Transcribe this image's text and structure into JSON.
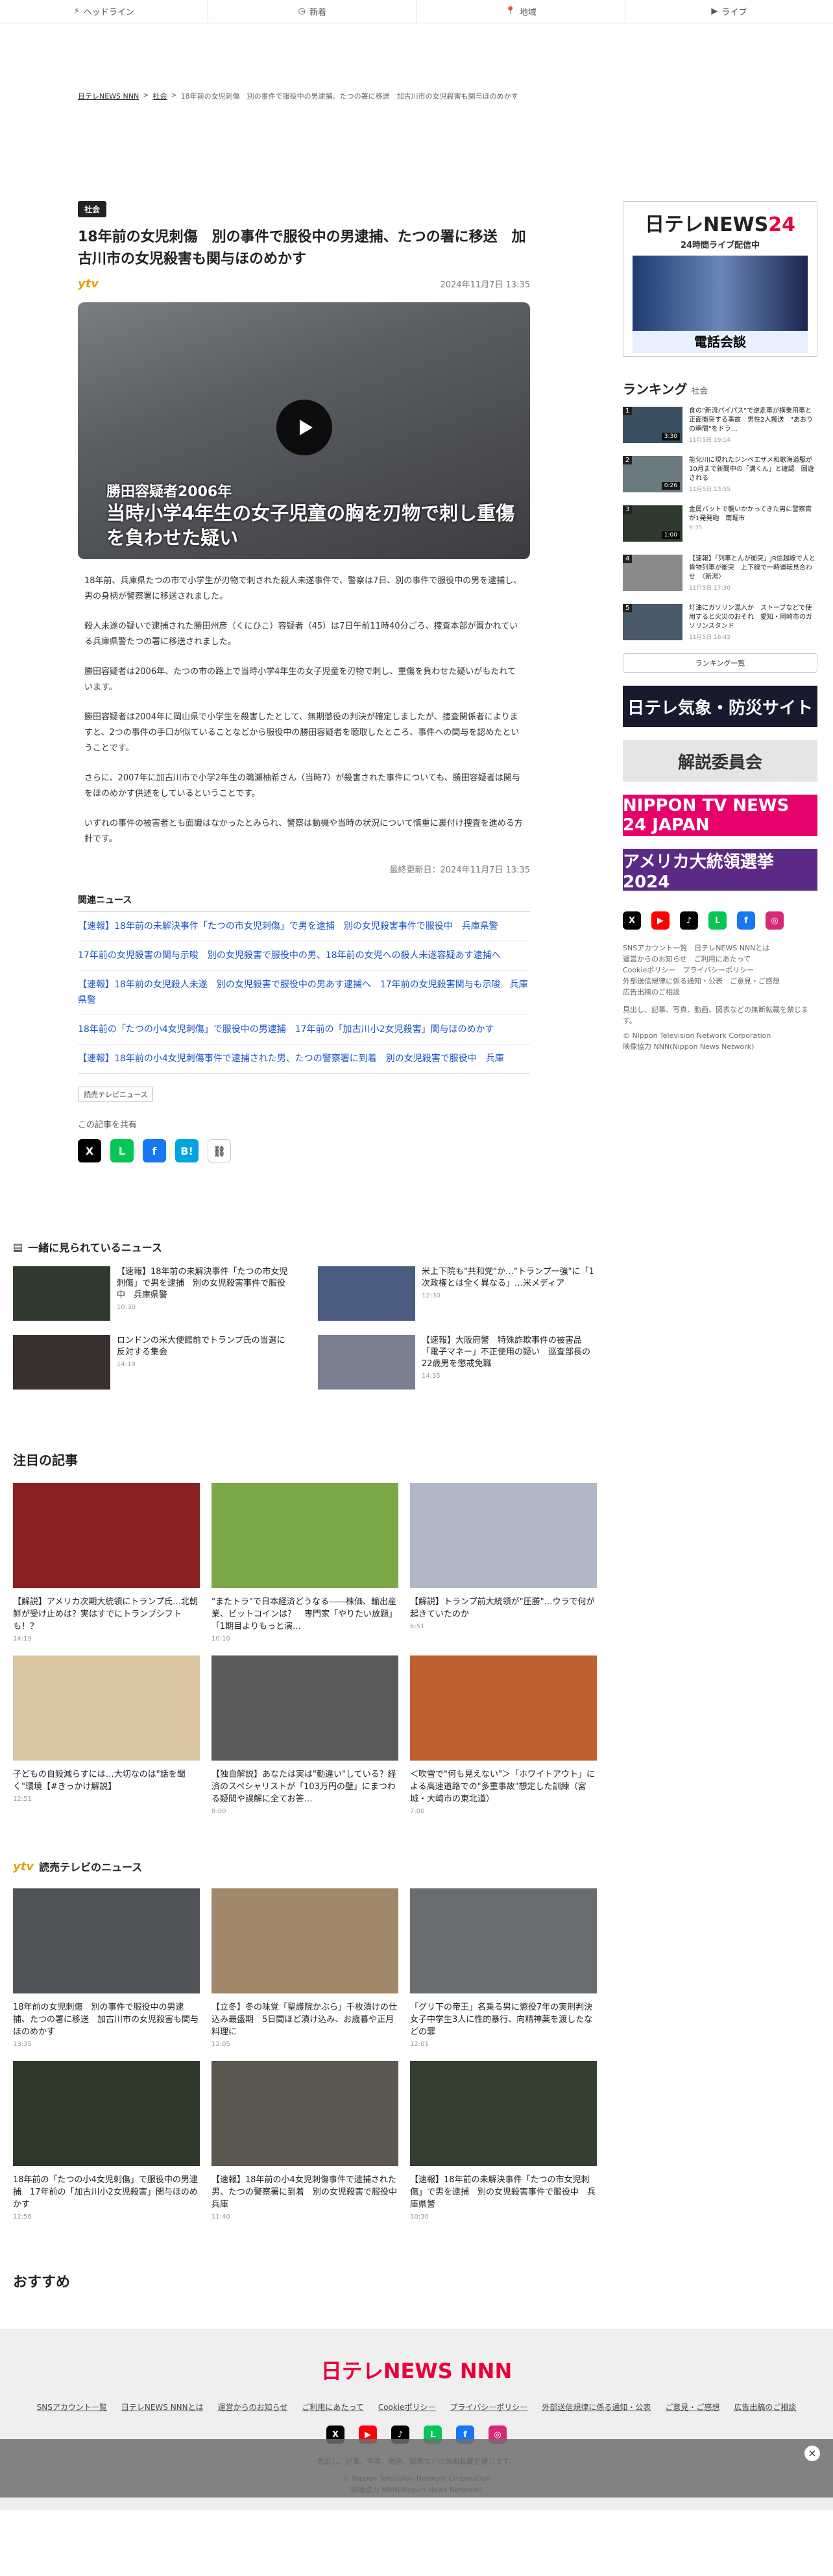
{
  "nav": [
    {
      "label": "ヘッドライン",
      "icon": "bolt-icon"
    },
    {
      "label": "新着",
      "icon": "clock-icon"
    },
    {
      "label": "地域",
      "icon": "pin-icon"
    },
    {
      "label": "ライブ",
      "icon": "play-icon"
    }
  ],
  "breadcrumb": {
    "home": "日テレNEWS NNN",
    "sep": ">",
    "category": "社会",
    "current": "18年前の女児刺傷　別の事件で服役中の男逮捕、たつの署に移送　加古川市の女児殺害も関与ほのめかす"
  },
  "article": {
    "category": "社会",
    "title": "18年前の女児刺傷　別の事件で服役中の男逮捕、たつの署に移送　加古川市の女児殺害も関与ほのめかす",
    "source_logo": "ytv",
    "date": "2024年11月7日 13:35",
    "video_caption_small": "勝田容疑者2006年",
    "video_caption_big": "当時小学4年生の女子児童の胸を刃物で刺し重傷を負わせた疑い",
    "paragraphs": [
      "18年前、兵庫県たつの市で小学生が刃物で刺された殺人未遂事件で、警察は7日、別の事件で服役中の男を逮捕し、男の身柄が警察署に移送されました。",
      "殺人未遂の疑いで逮捕された勝田州彦（くにひこ）容疑者（45）は7日午前11時40分ごろ、捜査本部が置かれている兵庫県警たつの署に移送されました。",
      "勝田容疑者は2006年、たつの市の路上で当時小学4年生の女子児童を刃物で刺し、重傷を負わせた疑いがもたれています。",
      "勝田容疑者は2004年に岡山県で小学生を殺害したとして、無期懲役の判決が確定しましたが、捜査関係者によりますと、2つの事件の手口が似ていることなどから服役中の勝田容疑者を聴取したところ、事件への関与を認めたということです。",
      "さらに、2007年に加古川市で小学2年生の鵜瀬柚希さん（当時7）が殺害された事件についても、勝田容疑者は関与をほのめかす供述をしているということです。",
      "いずれの事件の被害者とも面識はなかったとみられ、警察は動機や当時の状況について慎重に裏付け捜査を進める方針です。"
    ],
    "updated": "最終更新日：2024年11月7日 13:35",
    "related_heading": "関連ニュース",
    "related": [
      "【速報】18年前の未解決事件「たつの市女児刺傷」で男を逮捕　別の女児殺害事件で服役中　兵庫県警",
      "17年前の女児殺害の関与示唆　別の女児殺害で服役中の男、18年前の女児への殺人未遂容疑あす逮捕へ",
      "【速報】18年前の女児殺人未遂　別の女児殺害で服役中の男あす逮捕へ　17年前の女児殺害関与も示唆　兵庫県警",
      "18年前の「たつの小4女児刺傷」で服役中の男逮捕　17年前の「加古川小2女児殺害」関与ほのめかす",
      "【速報】18年前の小4女児刺傷事件で逮捕された男、たつの警察署に到着　別の女児殺害で服役中　兵庫"
    ],
    "source_tag": "読売テレビニュース",
    "share_label": "この記事を共有"
  },
  "share_icons": [
    {
      "name": "x-share-icon",
      "glyph": "X",
      "color": "#000000"
    },
    {
      "name": "line-share-icon",
      "glyph": "L",
      "color": "#06c755"
    },
    {
      "name": "facebook-share-icon",
      "glyph": "f",
      "color": "#1877f2"
    },
    {
      "name": "hatena-share-icon",
      "glyph": "B!",
      "color": "#00a4de"
    },
    {
      "name": "link-share-icon",
      "glyph": "⛓",
      "color": "#9aa0a6"
    }
  ],
  "sidebar": {
    "live_logo_main": "日テレNEWS",
    "live_logo_num": "24",
    "live_sub": "24時間ライブ配信中",
    "live_bar": "電話会談",
    "ranking_title": "ランキング",
    "ranking_sub": "社会",
    "ranking": [
      {
        "text": "食の\"新流パイパス\"で逆走車が横乗用車と正面衝突する事故　男性2人搬送　\"あおりの瞬間\"をドラ…",
        "src": "11月5日 19:14",
        "dur": "3:30"
      },
      {
        "text": "能化川に現れたジンベエザメ和歌海道駆が10月まで新聞中の「溝くん」と確認　回遊される",
        "src": "11月5日 13:55",
        "dur": "0:26"
      },
      {
        "text": "金属バットで襲いかかってきた男に警察官が1発発砲　南堀市",
        "src": "9:35",
        "dur": "1:00"
      },
      {
        "text": "【速報】「列車とんが衝突」JR信越線で人と貨物列車が衝突　上下線で一時運転見合わせ　〈新潟〉",
        "src": "11月5日 17:30",
        "dur": ""
      },
      {
        "text": "灯油にガソリン混入か　ストーブなどで使用すると火災のおそれ　愛知・岡崎市のガソリンスタンド",
        "src": "11月5日 16:42",
        "dur": ""
      }
    ],
    "ranking_button": "ランキング一覧",
    "banners": [
      {
        "label": "日テレ気象・防災サイト",
        "bg": "#1a1a2e"
      },
      {
        "label": "解説委員会",
        "bg": "#e5e5e5"
      },
      {
        "label": "NIPPON TV NEWS 24 JAPAN",
        "bg": "#e8006b"
      },
      {
        "label": "アメリカ大統領選挙2024",
        "bg": "#5b2a86"
      }
    ],
    "sns": [
      {
        "name": "x-icon",
        "glyph": "X",
        "color": "#000000"
      },
      {
        "name": "youtube-icon",
        "glyph": "▶",
        "color": "#ff0000"
      },
      {
        "name": "tiktok-icon",
        "glyph": "♪",
        "color": "#000000"
      },
      {
        "name": "line-icon",
        "glyph": "L",
        "color": "#06c755"
      },
      {
        "name": "facebook-icon",
        "glyph": "f",
        "color": "#1877f2"
      },
      {
        "name": "instagram-icon",
        "glyph": "◎",
        "color": "#d62976"
      }
    ],
    "links_1": "SNSアカウント一覧　日テレNEWS NNNとは",
    "links_2": "運営からのお知らせ　ご利用にあたって",
    "links_3": "Cookieポリシー　プライバシーポリシー",
    "links_4": "外部送信規律に係る通知・公表　ご意見・ご感想",
    "links_5": "広告出稿のご相談",
    "notice": "見出し、記事、写真、動画、図表などの無断転載を禁じます。",
    "copyright_1": "© Nippon Television Network Corporation",
    "copyright_2": "映像協力 NNN(Nippon News Network)"
  },
  "together": {
    "heading": "一緒に見られているニュース",
    "items": [
      {
        "text": "【速報】18年前の未解決事件「たつの市女児刺傷」で男を逮捕　別の女児殺害事件で服役中　兵庫県警",
        "src": "10:30"
      },
      {
        "text": "米上下院も\"共和党\"か…\"トランプ一強\"に「1次政権とは全く異なる」…米メディア",
        "src": "12:30"
      },
      {
        "text": "ロンドンの米大使館前でトランプ氏の当選に反対する集会",
        "src": "14:19"
      },
      {
        "text": "【速報】大阪府警　特殊詐欺事件の被害品「電子マネー」不正使用の疑い　巡査部長の22歳男を懲戒免職",
        "src": "14:35"
      }
    ]
  },
  "attention": {
    "heading": "注目の記事",
    "items": [
      {
        "text": "【解説】アメリカ次期大統領にトランプ氏…北朝鮮が受け止めは？実はすでにトランプシフトも！？",
        "src": "14:19"
      },
      {
        "text": "\"またトラ\"で日本経済どうなる――株価、輸出産業、ビットコインは？　専門家「やりたい放題」「1期目よりもっと演…",
        "src": "10:10"
      },
      {
        "text": "【解説】トランプ前大統領が\"圧勝\"…ウラで何が起きていたのか",
        "src": "6:51"
      },
      {
        "text": "子どもの自殺減らすには…大切なのは\"話を聞く\"環境【#きっかけ解説】",
        "src": "12:51"
      },
      {
        "text": "【独自解説】あなたは実は\"勤違い\"している？経済のスペシャリストが「103万円の壁」にまつわる疑問や誤解に全てお答…",
        "src": "8:00"
      },
      {
        "text": "＜吹雪で\"何も見えない\"＞「ホワイトアウト」による高速道路での\"多重事故\"想定した訓練（宮城・大崎市の東北道）",
        "src": "7:00"
      }
    ]
  },
  "ytv_section": {
    "heading": "読売テレビのニュース",
    "items": [
      {
        "text": "18年前の女児刺傷　別の事件で服役中の男逮捕、たつの署に移送　加古川市の女児殺害も関与ほのめかす",
        "src": "13:35"
      },
      {
        "text": "【立冬】冬の味覚「聖護院かぶら」千枚漬けの仕込み最盛期　5日間ほど漬け込み、お歳暮や正月料理に",
        "src": "12:05"
      },
      {
        "text": "「グリ下の帝王」名乗る男に懲役7年の実刑判決　女子中学生3人に性的暴行、向精神薬を渡したなどの罪",
        "src": "12:01"
      },
      {
        "text": "18年前の「たつの小4女児刺傷」で服役中の男逮捕　17年前の「加古川小2女児殺害」関与ほのめかす",
        "src": "12:56"
      },
      {
        "text": "【速報】18年前の小4女児刺傷事件で逮捕された男、たつの警察署に到着　別の女児殺害で服役中　兵庫",
        "src": "11:40"
      },
      {
        "text": "【速報】18年前の未解決事件「たつの市女児刺傷」で男を逮捕　別の女児殺害事件で服役中　兵庫県警",
        "src": "10:30"
      }
    ]
  },
  "osusume": "おすすめ",
  "footer": {
    "logo": "日テレNEWS NNN",
    "links": [
      "SNSアカウント一覧",
      "日テレNEWS NNNとは",
      "運営からのお知らせ",
      "ご利用にあたって",
      "Cookieポリシー",
      "プライバシーポリシー",
      "外部送信規律に係る通知・公表",
      "ご意見・ご感想",
      "広告出稿のご相談"
    ],
    "notice": "見出し、記事、写真、動画、図表などの無断転載を禁じます。",
    "copyright_1": "© Nippon Television Network Corporation",
    "copyright_2": "映像協力 NNN(Nippon News Network)"
  }
}
